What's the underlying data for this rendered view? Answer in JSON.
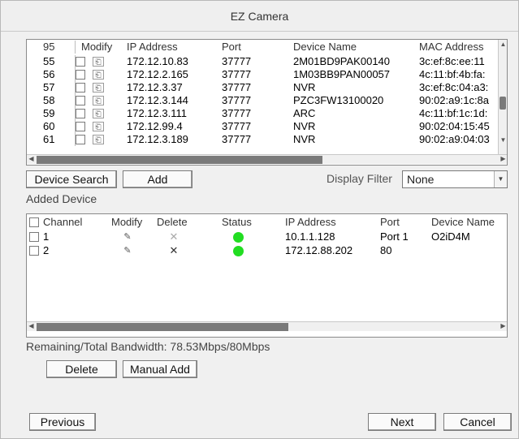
{
  "window": {
    "title": "EZ Camera"
  },
  "search_table": {
    "headers": {
      "index": "95",
      "modify": "Modify",
      "ip": "IP Address",
      "port": "Port",
      "device_name": "Device Name",
      "mac": "MAC Address"
    },
    "rows": [
      {
        "index": "55",
        "ip": "172.12.10.83",
        "port": "37777",
        "device_name": "2M01BD9PAK00140",
        "mac": "3c:ef:8c:ee:11"
      },
      {
        "index": "56",
        "ip": "172.12.2.165",
        "port": "37777",
        "device_name": "1M03BB9PAN00057",
        "mac": "4c:11:bf:4b:fa:"
      },
      {
        "index": "57",
        "ip": "172.12.3.37",
        "port": "37777",
        "device_name": "NVR",
        "mac": "3c:ef:8c:04:a3:"
      },
      {
        "index": "58",
        "ip": "172.12.3.144",
        "port": "37777",
        "device_name": "PZC3FW13100020",
        "mac": "90:02:a9:1c:8a"
      },
      {
        "index": "59",
        "ip": "172.12.3.111",
        "port": "37777",
        "device_name": "ARC",
        "mac": "4c:11:bf:1c:1d:"
      },
      {
        "index": "60",
        "ip": "172.12.99.4",
        "port": "37777",
        "device_name": "NVR",
        "mac": "90:02:04:15:45"
      },
      {
        "index": "61",
        "ip": "172.12.3.189",
        "port": "37777",
        "device_name": "NVR",
        "mac": "90:02:a9:04:03"
      }
    ]
  },
  "actions": {
    "device_search": "Device Search",
    "add": "Add",
    "display_filter_label": "Display Filter",
    "display_filter_value": "None"
  },
  "added_section_label": "Added Device",
  "added_table": {
    "headers": {
      "channel": "Channel",
      "modify": "Modify",
      "delete": "Delete",
      "status": "Status",
      "ip": "IP Address",
      "port": "Port",
      "device_name": "Device Name"
    },
    "rows": [
      {
        "channel": "1",
        "ip": "10.1.1.128",
        "port": "Port 1",
        "device_name": "O2iD4M",
        "status_color": "#22dd22",
        "delete_enabled": false
      },
      {
        "channel": "2",
        "ip": "172.12.88.202",
        "port": "80",
        "device_name": "",
        "status_color": "#22dd22",
        "delete_enabled": true
      }
    ]
  },
  "bandwidth_text": "Remaining/Total Bandwidth: 78.53Mbps/80Mbps",
  "bottom_buttons": {
    "delete": "Delete",
    "manual_add": "Manual Add"
  },
  "footer": {
    "previous": "Previous",
    "next": "Next",
    "cancel": "Cancel"
  },
  "colors": {
    "status_online": "#22dd22",
    "scroll_thumb": "#7a7a7a"
  },
  "icons": {
    "modify": "edit-icon",
    "pencil": "pencil-icon",
    "delete": "x-icon"
  }
}
